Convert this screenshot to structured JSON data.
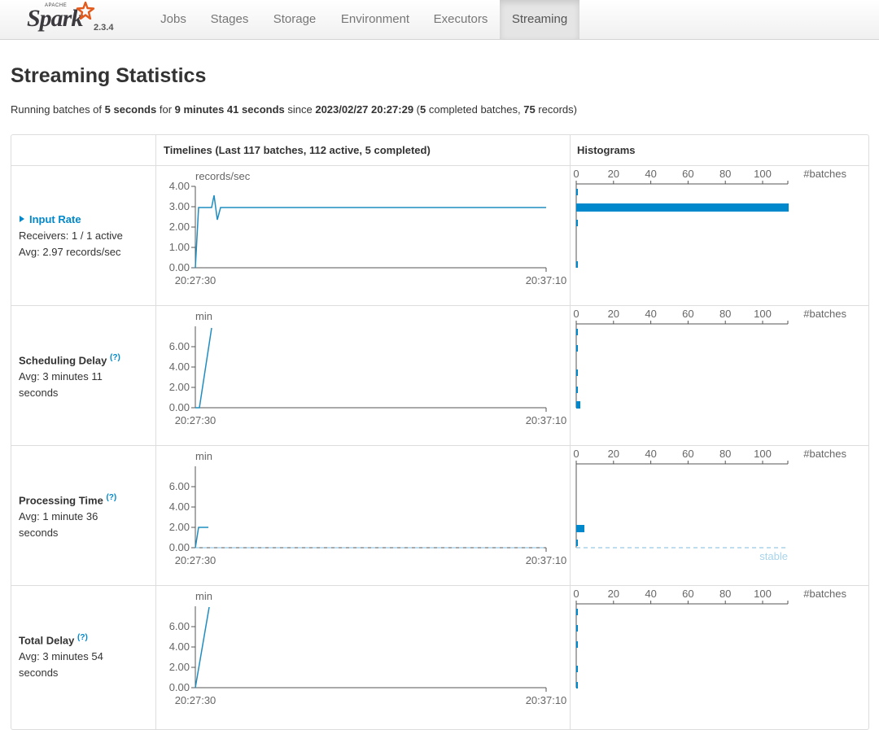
{
  "navbar": {
    "brand_apache": "APACHE",
    "brand_name": "Spark",
    "version": "2.3.4",
    "tabs": [
      {
        "label": "Jobs",
        "active": false
      },
      {
        "label": "Stages",
        "active": false
      },
      {
        "label": "Storage",
        "active": false
      },
      {
        "label": "Environment",
        "active": false
      },
      {
        "label": "Executors",
        "active": false
      },
      {
        "label": "Streaming",
        "active": true
      }
    ]
  },
  "page_title": "Streaming Statistics",
  "summary": {
    "prefix": "Running batches of ",
    "batch_interval": "5 seconds",
    "for_text": " for ",
    "duration": "9 minutes 41 seconds",
    "since_text": " since ",
    "start_time": "2023/02/27 20:27:29",
    "open_paren": " (",
    "completed_batches": "5",
    "completed_text": " completed batches, ",
    "records": "75",
    "records_text": " records)"
  },
  "table": {
    "timelines_header": "Timelines (Last 117 batches, 112 active, 5 completed)",
    "histograms_header": "Histograms"
  },
  "rows": [
    {
      "name": "Input Rate",
      "line2": "Receivers: 1 / 1 active",
      "line3": "Avg: 2.97 records/sec",
      "unit": "records/sec",
      "y_ticks": [
        "4.00",
        "3.00",
        "2.00",
        "1.00",
        "0.00"
      ],
      "x_start": "20:27:30",
      "x_end": "20:37:10"
    },
    {
      "name": "Scheduling Delay",
      "help": "(?)",
      "line2": "Avg: 3 minutes 11",
      "line3": "seconds",
      "unit": "min",
      "y_ticks": [
        "6.00",
        "4.00",
        "2.00",
        "0.00"
      ],
      "x_start": "20:27:30",
      "x_end": "20:37:10"
    },
    {
      "name": "Processing Time",
      "help": "(?)",
      "line2": "Avg: 1 minute 36",
      "line3": "seconds",
      "unit": "min",
      "y_ticks": [
        "6.00",
        "4.00",
        "2.00",
        "0.00"
      ],
      "x_start": "20:27:30",
      "x_end": "20:37:10",
      "stable_label": "stable"
    },
    {
      "name": "Total Delay",
      "help": "(?)",
      "line2": "Avg: 3 minutes 54",
      "line3": "seconds",
      "unit": "min",
      "y_ticks": [
        "6.00",
        "4.00",
        "2.00",
        "0.00"
      ],
      "x_start": "20:27:30",
      "x_end": "20:37:10"
    }
  ],
  "histogram": {
    "x_ticks": [
      "0",
      "20",
      "40",
      "60",
      "80",
      "100"
    ],
    "unit": "#batches"
  },
  "colors": {
    "series": "#1f8dc1",
    "bar": "#0088cc",
    "stable": "#a8d4ea",
    "link": "#0088cc"
  }
}
